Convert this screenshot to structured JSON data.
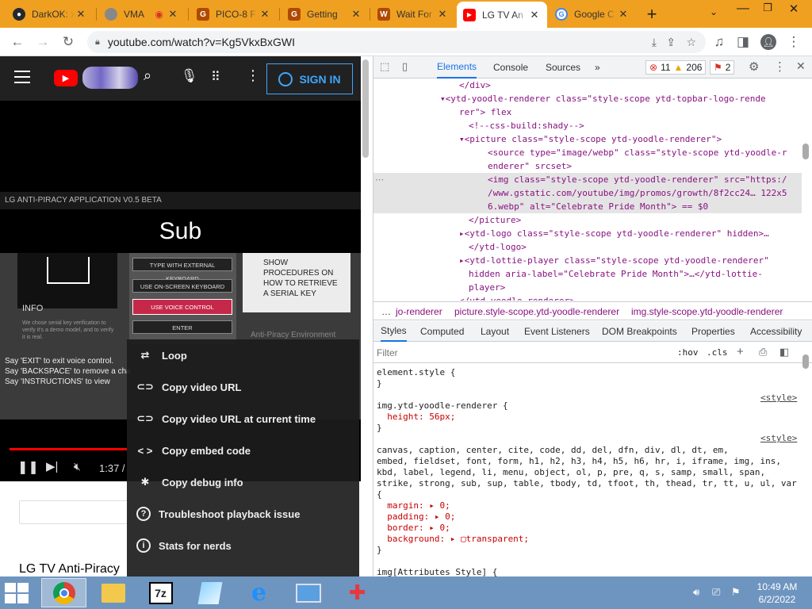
{
  "browser": {
    "tabs": [
      {
        "title": "DarkOK: x",
        "icon": "github-icon",
        "color": "#24292f"
      },
      {
        "title": "VMA",
        "icon": "globe-icon",
        "color": "#777"
      },
      {
        "title": "PICO-8 F",
        "icon": "g-icon",
        "color": "#b04a00"
      },
      {
        "title": "Getting",
        "icon": "g-icon",
        "color": "#b04a00"
      },
      {
        "title": "Wait For",
        "icon": "w-icon",
        "color": "#b04a00"
      },
      {
        "title": "LG TV An",
        "icon": "youtube-icon",
        "color": "#ff0000",
        "active": true
      },
      {
        "title": "Google C",
        "icon": "google-icon",
        "color": "#4285f4"
      }
    ],
    "new_tab": "+",
    "url": "youtube.com/watch?v=Kg5VkxBxGWI"
  },
  "youtube": {
    "signin_label": "SIGN IN",
    "player": {
      "app_title": "LG ANTI-PIRACY APPLICATION V0.5 BETA",
      "heading": "Sub",
      "info_title": "INFO",
      "info_text": "We chose serial key verification to verify it's a demo model, and to verify it is real.",
      "buttons": [
        "TYPE WITH EXTERNAL KEYBOARD",
        "USE ON-SCREEN KEYBOARD",
        "USE VOICE CONTROL",
        "ENTER"
      ],
      "procedures": "SHOW PROCEDURES ON HOW TO RETRIEVE A SERIAL KEY",
      "env_label": "Anti-Piracy Environment",
      "voice_lines": [
        "Say 'EXIT' to exit voice control.",
        "Say 'BACKSPACE' to remove a cha",
        "Say 'INSTRUCTIONS' to view"
      ],
      "time": "1:37 /"
    },
    "video_title": "LG TV Anti-Piracy",
    "context_menu": [
      {
        "label": "Loop",
        "icon": "loop-icon"
      },
      {
        "label": "Copy video URL",
        "icon": "link-icon"
      },
      {
        "label": "Copy video URL at current time",
        "icon": "link-icon"
      },
      {
        "label": "Copy embed code",
        "icon": "embed-icon"
      },
      {
        "label": "Copy debug info",
        "icon": "bug-icon"
      },
      {
        "label": "Troubleshoot playback issue",
        "icon": "help-icon"
      },
      {
        "label": "Stats for nerds",
        "icon": "info-icon"
      }
    ]
  },
  "devtools": {
    "tabs": [
      "Elements",
      "Console",
      "Sources"
    ],
    "errors": "11",
    "warnings": "206",
    "issues": "2",
    "dom_lines": [
      {
        "indent": 9,
        "html": "</div>"
      },
      {
        "indent": 7,
        "html": "▾<ytd-yoodle-renderer class=\"style-scope ytd-topbar-logo-rende"
      },
      {
        "indent": 9,
        "html": "rer\"> flex"
      },
      {
        "indent": 10,
        "html": "<!--css-build:shady-->"
      },
      {
        "indent": 9,
        "html": "▾<picture class=\"style-scope ytd-yoodle-renderer\">"
      },
      {
        "indent": 12,
        "html": "<source type=\"image/webp\" class=\"style-scope ytd-yoodle-r"
      },
      {
        "indent": 12,
        "html": "enderer\" srcset>"
      },
      {
        "indent": 12,
        "html": "<img class=\"style-scope ytd-yoodle-renderer\" src=\"https:/"
      },
      {
        "indent": 12,
        "html": "/www.gstatic.com/youtube/img/promos/growth/8f2cc24… 122x5"
      },
      {
        "indent": 12,
        "html": "6.webp\" alt=\"Celebrate Pride Month\"> == $0"
      },
      {
        "indent": 10,
        "html": "</picture>"
      },
      {
        "indent": 9,
        "html": "▸<ytd-logo class=\"style-scope ytd-yoodle-renderer\" hidden>…"
      },
      {
        "indent": 10,
        "html": "</ytd-logo>"
      },
      {
        "indent": 9,
        "html": "▸<ytd-lottie-player class=\"style-scope ytd-yoodle-renderer\""
      },
      {
        "indent": 10,
        "html": "hidden aria-label=\"Celebrate Pride Month\">…</ytd-lottie-"
      },
      {
        "indent": 10,
        "html": "player>"
      },
      {
        "indent": 9,
        "html": "</ytd-yoodle-renderer>"
      }
    ],
    "breadcrumbs": [
      "…",
      "jo-renderer",
      "picture.style-scope.ytd-yoodle-renderer",
      "img.style-scope.ytd-yoodle-renderer"
    ],
    "style_tabs": [
      "Styles",
      "Computed",
      "Layout",
      "Event Listeners",
      "DOM Breakpoints",
      "Properties",
      "Accessibility"
    ],
    "filter_placeholder": "Filter",
    "hov": ":hov",
    "cls": ".cls",
    "style_lines": [
      "element.style {",
      "}",
      "",
      "img.ytd-yoodle-renderer {",
      "  height: 56px;",
      "}",
      "",
      "canvas, caption, center, cite, code, dd, del, dfn, div, dl, dt, em,",
      "embed, fieldset, font, form, h1, h2, h3, h4, h5, h6, hr, i, iframe, img, ins,",
      "kbd, label, legend, li, menu, object, ol, p, pre, q, s, samp, small, span,",
      "strike, strong, sub, sup, table, tbody, td, tfoot, th, thead, tr, tt, u, ul, var",
      "{",
      "  margin: ▸ 0;",
      "  padding: ▸ 0;",
      "  border: ▸ 0;",
      "  background: ▸ ▢transparent;",
      "}",
      "",
      "img[Attributes Style] {",
      "}"
    ],
    "style_source": "<style>"
  },
  "taskbar": {
    "time": "10:49 AM",
    "date": "6/2/2022",
    "apps": [
      "chrome-icon",
      "explorer-icon",
      "7zip-icon",
      "notepad-icon",
      "ie-icon",
      "rdp-icon",
      "paint-icon"
    ]
  }
}
